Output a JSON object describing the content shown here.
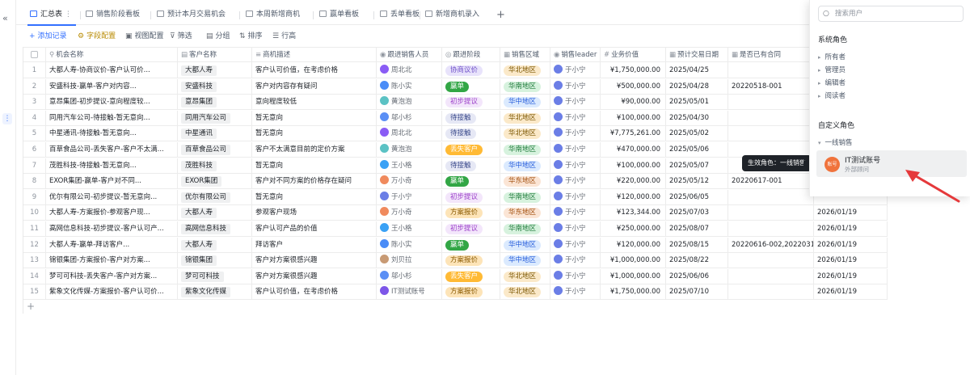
{
  "app": {
    "collapse_icon": "«"
  },
  "tabs": [
    {
      "label": "汇总表",
      "active": true
    },
    {
      "label": "销售阶段看板"
    },
    {
      "label": "预计本月交易机会"
    },
    {
      "label": "本周新增商机"
    },
    {
      "label": "赢单看板"
    },
    {
      "label": "丢单看板"
    },
    {
      "label": "新增商机录入"
    }
  ],
  "add_tab": "+",
  "tab_more": "⋮",
  "toolbar": {
    "add_record": "添加记录",
    "field_config": "字段配置",
    "view_config": "视图配置",
    "filter": "筛选",
    "group": "分组",
    "sort": "排序",
    "row_height": "行高"
  },
  "columns": [
    "机会名称",
    "客户名称",
    "商机描述",
    "跟进销售人员",
    "跟进阶段",
    "销售区域",
    "销售leader",
    "业务价值",
    "预计交易日期",
    "是否已有合同"
  ],
  "rows": [
    {
      "n": "1",
      "name": "大都人寿-协商议价-客户认可价...",
      "cust": "大都人寿",
      "desc": "客户认可价值，在考虑价格",
      "rep": "周北北",
      "stage": "协商议价",
      "region": "华北地区",
      "leader": "于小宁",
      "value": "¥1,750,000.00",
      "date": "2025/04/25",
      "contract": "",
      "extra": ""
    },
    {
      "n": "2",
      "name": "安盛科技-赢单-客户对内容...",
      "cust": "安盛科技",
      "desc": "客户对内容存有疑问",
      "rep": "陈小实",
      "stage": "赢单",
      "region": "华南地区",
      "leader": "于小宁",
      "value": "¥500,000.00",
      "date": "2025/04/28",
      "contract": "20220518-001",
      "extra": ""
    },
    {
      "n": "3",
      "name": "意昂集团-初步提议-意向程度较...",
      "cust": "意昂集团",
      "desc": "意向程度较低",
      "rep": "黄泡泡",
      "stage": "初步提议",
      "region": "华中地区",
      "leader": "于小宁",
      "value": "¥90,000.00",
      "date": "2025/05/01",
      "contract": "",
      "extra": ""
    },
    {
      "n": "4",
      "name": "同用汽车公司-待接触-暂无意向...",
      "cust": "同用汽车公司",
      "desc": "暂无意向",
      "rep": "邬小杉",
      "stage": "待接触",
      "region": "华北地区",
      "leader": "于小宁",
      "value": "¥100,000.00",
      "date": "2025/04/30",
      "contract": "",
      "extra": ""
    },
    {
      "n": "5",
      "name": "中星通讯-待接触-暂无意向...",
      "cust": "中星通讯",
      "desc": "暂无意向",
      "rep": "周北北",
      "stage": "待接触",
      "region": "华北地区",
      "leader": "于小宁",
      "value": "¥7,775,261.00",
      "date": "2025/05/02",
      "contract": "",
      "extra": ""
    },
    {
      "n": "6",
      "name": "百草食品公司-丢失客户-客户不太满...",
      "cust": "百草食品公司",
      "desc": "客户不太满意目前的定价方案",
      "rep": "黄泡泡",
      "stage": "丢失客户",
      "region": "华南地区",
      "leader": "于小宁",
      "value": "¥470,000.00",
      "date": "2025/05/06",
      "contract": "",
      "extra": ""
    },
    {
      "n": "7",
      "name": "茂胜科技-待接触-暂无意向...",
      "cust": "茂胜科技",
      "desc": "暂无意向",
      "rep": "王小格",
      "stage": "待接触",
      "region": "华中地区",
      "leader": "于小宁",
      "value": "¥100,000.00",
      "date": "2025/05/07",
      "contract": "",
      "extra": ""
    },
    {
      "n": "8",
      "name": "EXOR集团-赢单-客户对不同...",
      "cust": "EXOR集团",
      "desc": "客户对不同方案的价格存在疑问",
      "rep": "万小奇",
      "stage": "赢单",
      "region": "华东地区",
      "leader": "于小宁",
      "value": "¥220,000.00",
      "date": "2025/05/12",
      "contract": "20220617-001",
      "extra": ""
    },
    {
      "n": "9",
      "name": "优尔有限公司-初步提议-暂无意向...",
      "cust": "优尔有限公司",
      "desc": "暂无意向",
      "rep": "于小宁",
      "stage": "初步提议",
      "region": "华南地区",
      "leader": "于小宁",
      "value": "¥120,000.00",
      "date": "2025/06/05",
      "contract": "",
      "extra": ""
    },
    {
      "n": "10",
      "name": "大都人寿-方案报价-参观客户现...",
      "cust": "大都人寿",
      "desc": "参观客户现场",
      "rep": "万小奇",
      "stage": "方案报价",
      "region": "华东地区",
      "leader": "于小宁",
      "value": "¥123,344.00",
      "date": "2025/07/03",
      "contract": "",
      "extra": "2026/01/19"
    },
    {
      "n": "11",
      "name": "高网信息科技-初步提议-客户认可产...",
      "cust": "高网信息科技",
      "desc": "客户认可产品的价值",
      "rep": "王小格",
      "stage": "初步提议",
      "region": "华南地区",
      "leader": "于小宁",
      "value": "¥250,000.00",
      "date": "2025/08/07",
      "contract": "",
      "extra": "2026/01/19"
    },
    {
      "n": "12",
      "name": "大都人寿-赢单-拜访客户...",
      "cust": "大都人寿",
      "desc": "拜访客户",
      "rep": "陈小实",
      "stage": "赢单",
      "region": "华中地区",
      "leader": "于小宁",
      "value": "¥120,000.00",
      "date": "2025/08/15",
      "contract": "20220616-002,2022031...",
      "extra": "2026/01/19"
    },
    {
      "n": "13",
      "name": "锦银集团-方案报价-客户对方案...",
      "cust": "锦银集团",
      "desc": "客户对方案很感兴趣",
      "rep": "刘贝拉",
      "stage": "方案报价",
      "region": "华中地区",
      "leader": "于小宁",
      "value": "¥1,000,000.00",
      "date": "2025/08/22",
      "contract": "",
      "extra": "2026/01/19"
    },
    {
      "n": "14",
      "name": "梦可可科技-丢失客户-客户对方案...",
      "cust": "梦可可科技",
      "desc": "客户对方案很感兴趣",
      "rep": "邬小杉",
      "stage": "丢失客户",
      "region": "华北地区",
      "leader": "于小宁",
      "value": "¥1,000,000.00",
      "date": "2025/06/06",
      "contract": "",
      "extra": "2026/01/19"
    },
    {
      "n": "15",
      "name": "紫象文化传媒-方案报价-客户认可价...",
      "cust": "紫象文化传媒",
      "desc": "客户认可价值，在考虑价格",
      "rep": "IT测试账号",
      "stage": "方案报价",
      "region": "华北地区",
      "leader": "于小宁",
      "value": "¥1,750,000.00",
      "date": "2025/07/10",
      "contract": "",
      "extra": "2026/01/19"
    }
  ],
  "stage_colors": {
    "协商议价": {
      "bg": "#e8e3fb",
      "fg": "#6c4cc7"
    },
    "赢单": {
      "bg": "#32a645",
      "fg": "#ffffff"
    },
    "初步提议": {
      "bg": "#f3e6fb",
      "fg": "#9b3fc9"
    },
    "待接触": {
      "bg": "#e6e8f5",
      "fg": "#3b4a8c"
    },
    "丢失客户": {
      "bg": "#ffba35",
      "fg": "#ffffff"
    },
    "方案报价": {
      "bg": "#fde4b8",
      "fg": "#8a5a00"
    }
  },
  "region_colors": {
    "华北地区": {
      "bg": "#fbe9c9",
      "fg": "#7a5500"
    },
    "华南地区": {
      "bg": "#d7f2de",
      "fg": "#1e7a3a"
    },
    "华中地区": {
      "bg": "#dbeafe",
      "fg": "#245bdb"
    },
    "华东地区": {
      "bg": "#fbe5d5",
      "fg": "#a14d0b"
    }
  },
  "rep_colors": {
    "周北北": "#8a5cf5",
    "陈小实": "#4a8cf7",
    "黄泡泡": "#5bc2c4",
    "邬小杉": "#5b8ff5",
    "王小格": "#3aa1f5",
    "万小奇": "#f08a5d",
    "于小宁": "#6b7ee6",
    "刘贝拉": "#c89a74",
    "IT测试账号": "#7d56e8"
  },
  "tooltip": "生效角色：一线销售",
  "panel": {
    "search_placeholder": "搜索用户",
    "system_roles": "系统角色",
    "system_items": [
      "所有者",
      "管理员",
      "编辑者",
      "阅读者"
    ],
    "custom_roles": "自定义角色",
    "custom_group": "一线销售",
    "selected_name": "IT测试账号",
    "selected_sub": "外部顾问",
    "selected_avatar": "账号"
  },
  "add_row": "+"
}
